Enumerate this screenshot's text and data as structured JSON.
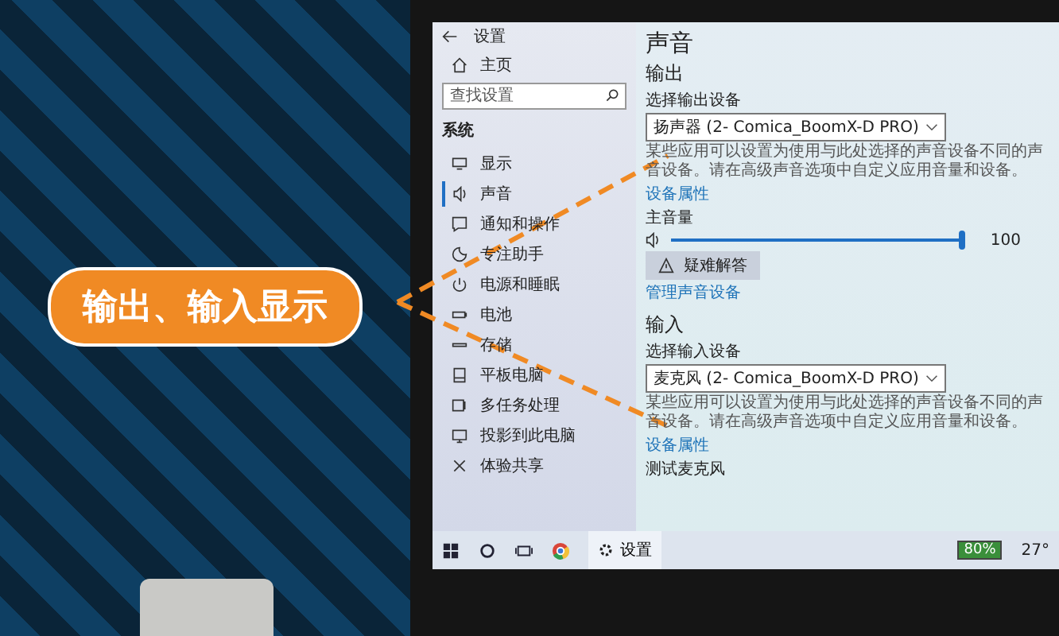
{
  "callout": {
    "label": "输出、输入显示"
  },
  "window": {
    "title": "设置"
  },
  "sidebar": {
    "home": "主页",
    "search": {
      "placeholder": "查找设置"
    },
    "section": "系统",
    "items": [
      {
        "label": "显示",
        "selected": false
      },
      {
        "label": "声音",
        "selected": true
      },
      {
        "label": "通知和操作",
        "selected": false
      },
      {
        "label": "专注助手",
        "selected": false
      },
      {
        "label": "电源和睡眠",
        "selected": false
      },
      {
        "label": "电池",
        "selected": false
      },
      {
        "label": "存储",
        "selected": false
      },
      {
        "label": "平板电脑",
        "selected": false
      },
      {
        "label": "多任务处理",
        "selected": false
      },
      {
        "label": "投影到此电脑",
        "selected": false
      },
      {
        "label": "体验共享",
        "selected": false
      }
    ]
  },
  "content": {
    "title": "声音",
    "output": {
      "heading": "输出",
      "device_label": "选择输出设备",
      "device": "扬声器 (2- Comica_BoomX-D PRO)",
      "description": "某些应用可以设置为使用与此处选择的声音设备不同的声音设备。请在高级声音选项中自定义应用音量和设备。",
      "link": "设备属性",
      "volume_label": "主音量",
      "volume": {
        "level": 1.0,
        "reading": "100"
      },
      "troubleshoot": "疑难解答",
      "manage_link": "管理声音设备"
    },
    "input": {
      "heading": "输入",
      "device_label": "选择输入设备",
      "device": "麦克风 (2- Comica_BoomX-D PRO)",
      "description": "某些应用可以设置为使用与此处选择的声音设备不同的声音设备。请在高级声音选项中自定义应用音量和设备。",
      "link": "设备属性",
      "test_label": "测试麦克风"
    }
  },
  "taskbar": {
    "app": "设置",
    "battery": "80%",
    "temperature": "27°"
  }
}
